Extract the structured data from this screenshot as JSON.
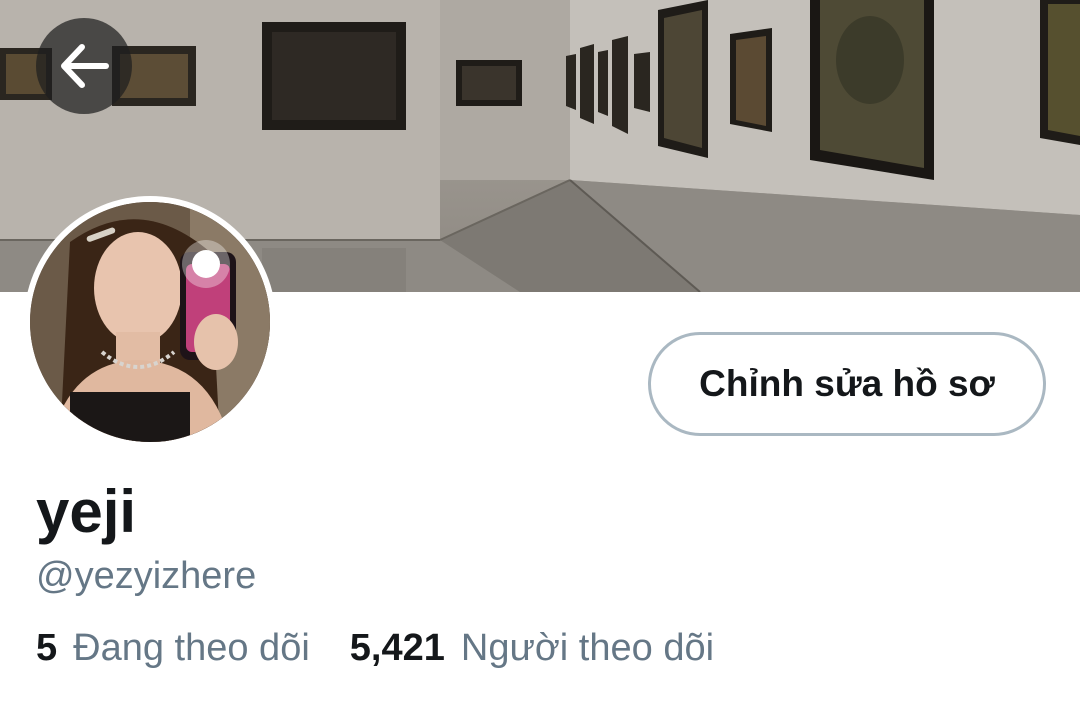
{
  "profile": {
    "display_name": "yeji",
    "handle": "@yezyizhere",
    "edit_button_label": "Chỉnh sửa hồ sơ"
  },
  "stats": {
    "following_count": "5",
    "following_label": "Đang theo dõi",
    "followers_count": "5,421",
    "followers_label": "Người theo dõi"
  },
  "icons": {
    "back": "arrow-left-icon"
  },
  "colors": {
    "primary_text": "#14171a",
    "secondary_text": "#657786",
    "button_border": "#aab8c2",
    "back_button_bg": "#1e1e1e"
  }
}
